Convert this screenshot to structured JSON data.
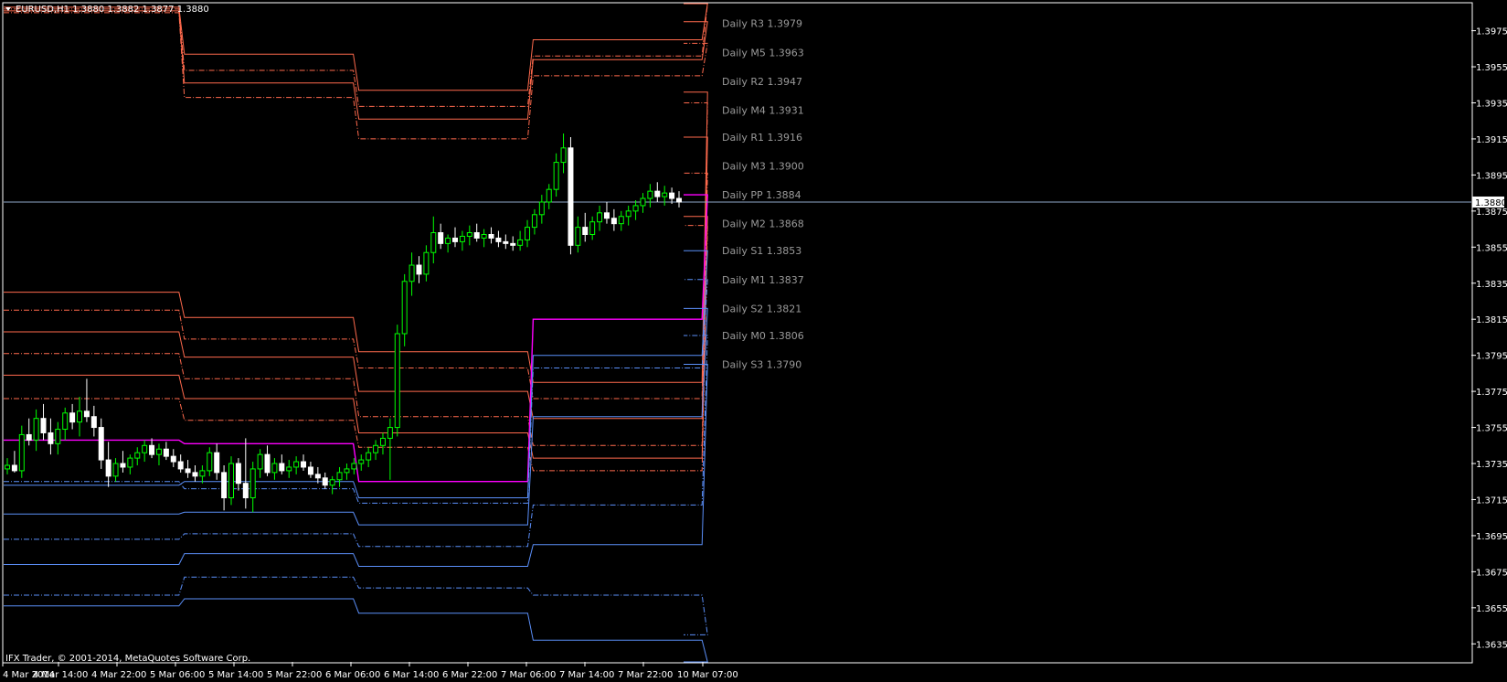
{
  "chart_title": "EURUSD,H1  1.3880 1.3882 1.3877 1.3880",
  "footer": "IFX Trader, © 2001-2014, MetaQuotes Software Corp.",
  "colors": {
    "background": "#000000",
    "grid_frame": "#ffffff",
    "bull_candle": "#00ff00",
    "bear_candle": "#ffffff",
    "resistance": "#ff6a4d",
    "pivot": "#ff00ff",
    "support": "#5b8ff9",
    "bid_line": "#8fa8c8",
    "label_text": "#9a9a9a"
  },
  "chart_data": {
    "type": "candlestick",
    "symbol": "EURUSD",
    "timeframe": "H1",
    "ylim": [
      1.3625,
      1.399
    ],
    "y_ticks": [
      "1.3975",
      "1.3955",
      "1.3935",
      "1.3915",
      "1.3895",
      "1.3875",
      "1.3855",
      "1.3835",
      "1.3815",
      "1.3795",
      "1.3775",
      "1.3755",
      "1.3735",
      "1.3715",
      "1.3695",
      "1.3675",
      "1.3655",
      "1.3635"
    ],
    "x_ticks": [
      "4 Mar 2014",
      "4 Mar 14:00",
      "4 Mar 22:00",
      "5 Mar 06:00",
      "5 Mar 14:00",
      "5 Mar 22:00",
      "6 Mar 06:00",
      "6 Mar 14:00",
      "6 Mar 22:00",
      "7 Mar 06:00",
      "7 Mar 14:00",
      "7 Mar 22:00",
      "10 Mar 07:00"
    ],
    "bar_range": [
      0,
      124
    ],
    "current_price": "1.3880",
    "candles_ohlc": [
      [
        1.3732,
        1.3738,
        1.3729,
        1.3734
      ],
      [
        1.3734,
        1.3742,
        1.373,
        1.3731
      ],
      [
        1.3731,
        1.3756,
        1.3727,
        1.3751
      ],
      [
        1.3751,
        1.376,
        1.3745,
        1.3748
      ],
      [
        1.3748,
        1.3765,
        1.3742,
        1.376
      ],
      [
        1.376,
        1.3768,
        1.3748,
        1.3752
      ],
      [
        1.3752,
        1.376,
        1.374,
        1.3746
      ],
      [
        1.3746,
        1.3758,
        1.374,
        1.3754
      ],
      [
        1.3754,
        1.3766,
        1.3748,
        1.3763
      ],
      [
        1.3763,
        1.3768,
        1.3754,
        1.3758
      ],
      [
        1.3758,
        1.3772,
        1.375,
        1.3764
      ],
      [
        1.3764,
        1.3782,
        1.3758,
        1.3761
      ],
      [
        1.3761,
        1.3767,
        1.375,
        1.3755
      ],
      [
        1.3755,
        1.376,
        1.3732,
        1.3737
      ],
      [
        1.3737,
        1.3747,
        1.3722,
        1.3728
      ],
      [
        1.3728,
        1.3738,
        1.3725,
        1.3735
      ],
      [
        1.3735,
        1.3742,
        1.373,
        1.3733
      ],
      [
        1.3733,
        1.374,
        1.3729,
        1.3738
      ],
      [
        1.3738,
        1.3744,
        1.3734,
        1.3741
      ],
      [
        1.3741,
        1.3748,
        1.3736,
        1.3745
      ],
      [
        1.3745,
        1.3749,
        1.3738,
        1.374
      ],
      [
        1.374,
        1.3746,
        1.3734,
        1.3743
      ],
      [
        1.3743,
        1.3747,
        1.3737,
        1.3739
      ],
      [
        1.3739,
        1.3743,
        1.3733,
        1.3736
      ],
      [
        1.3736,
        1.374,
        1.373,
        1.3732
      ],
      [
        1.3732,
        1.3737,
        1.3727,
        1.373
      ],
      [
        1.373,
        1.3734,
        1.3725,
        1.3728
      ],
      [
        1.3728,
        1.3734,
        1.3724,
        1.3731
      ],
      [
        1.3731,
        1.3744,
        1.3728,
        1.3741
      ],
      [
        1.3741,
        1.3746,
        1.3726,
        1.373
      ],
      [
        1.373,
        1.3734,
        1.3709,
        1.3716
      ],
      [
        1.3716,
        1.3739,
        1.3712,
        1.3735
      ],
      [
        1.3735,
        1.3738,
        1.372,
        1.3724
      ],
      [
        1.3724,
        1.3749,
        1.371,
        1.3716
      ],
      [
        1.3716,
        1.3736,
        1.3708,
        1.3732
      ],
      [
        1.3732,
        1.3743,
        1.3727,
        1.374
      ],
      [
        1.374,
        1.3745,
        1.3728,
        1.373
      ],
      [
        1.373,
        1.3738,
        1.3726,
        1.3735
      ],
      [
        1.3735,
        1.374,
        1.3729,
        1.3731
      ],
      [
        1.3731,
        1.3737,
        1.3727,
        1.3733
      ],
      [
        1.3733,
        1.3739,
        1.3729,
        1.3736
      ],
      [
        1.3736,
        1.374,
        1.3731,
        1.3733
      ],
      [
        1.3733,
        1.3736,
        1.3727,
        1.3729
      ],
      [
        1.3729,
        1.3733,
        1.3724,
        1.3727
      ],
      [
        1.3727,
        1.373,
        1.3721,
        1.3723
      ],
      [
        1.3723,
        1.3728,
        1.3718,
        1.3726
      ],
      [
        1.3726,
        1.3733,
        1.3722,
        1.373
      ],
      [
        1.373,
        1.3735,
        1.3726,
        1.3732
      ],
      [
        1.3732,
        1.3738,
        1.3729,
        1.3735
      ],
      [
        1.3735,
        1.374,
        1.3731,
        1.3737
      ],
      [
        1.3737,
        1.3744,
        1.3733,
        1.3741
      ],
      [
        1.3741,
        1.3748,
        1.3737,
        1.3745
      ],
      [
        1.3745,
        1.3752,
        1.374,
        1.3749
      ],
      [
        1.3749,
        1.376,
        1.3726,
        1.3755
      ],
      [
        1.3755,
        1.3812,
        1.375,
        1.3807
      ],
      [
        1.3807,
        1.384,
        1.38,
        1.3836
      ],
      [
        1.3836,
        1.3852,
        1.3828,
        1.3845
      ],
      [
        1.3845,
        1.385,
        1.3835,
        1.384
      ],
      [
        1.384,
        1.3856,
        1.3836,
        1.3852
      ],
      [
        1.3852,
        1.3872,
        1.3846,
        1.3863
      ],
      [
        1.3863,
        1.3868,
        1.3854,
        1.3857
      ],
      [
        1.3857,
        1.3862,
        1.3852,
        1.386
      ],
      [
        1.386,
        1.3866,
        1.3855,
        1.3858
      ],
      [
        1.3858,
        1.3864,
        1.3853,
        1.3861
      ],
      [
        1.3861,
        1.3867,
        1.3856,
        1.3863
      ],
      [
        1.3863,
        1.3868,
        1.3858,
        1.386
      ],
      [
        1.386,
        1.3865,
        1.3855,
        1.3862
      ],
      [
        1.3862,
        1.3866,
        1.3857,
        1.386
      ],
      [
        1.386,
        1.3864,
        1.3855,
        1.3858
      ],
      [
        1.3858,
        1.3862,
        1.3854,
        1.3857
      ],
      [
        1.3857,
        1.3861,
        1.3853,
        1.3856
      ],
      [
        1.3856,
        1.3864,
        1.3853,
        1.3859
      ],
      [
        1.3859,
        1.387,
        1.3855,
        1.3866
      ],
      [
        1.3866,
        1.3876,
        1.3862,
        1.3873
      ],
      [
        1.3873,
        1.3884,
        1.3868,
        1.388
      ],
      [
        1.388,
        1.389,
        1.3876,
        1.3887
      ],
      [
        1.3887,
        1.3907,
        1.3883,
        1.3902
      ],
      [
        1.3902,
        1.3918,
        1.3896,
        1.391
      ],
      [
        1.391,
        1.3916,
        1.3851,
        1.3856
      ],
      [
        1.3856,
        1.3872,
        1.3852,
        1.3866
      ],
      [
        1.3866,
        1.3874,
        1.3858,
        1.3862
      ],
      [
        1.3862,
        1.3872,
        1.3859,
        1.3869
      ],
      [
        1.3869,
        1.3878,
        1.3864,
        1.3874
      ],
      [
        1.3874,
        1.388,
        1.3868,
        1.3871
      ],
      [
        1.3871,
        1.3876,
        1.3864,
        1.3868
      ],
      [
        1.3868,
        1.3875,
        1.3864,
        1.3872
      ],
      [
        1.3872,
        1.3878,
        1.3867,
        1.3875
      ],
      [
        1.3875,
        1.3881,
        1.387,
        1.3878
      ],
      [
        1.3878,
        1.3885,
        1.3874,
        1.3882
      ],
      [
        1.3882,
        1.389,
        1.3877,
        1.3886
      ],
      [
        1.3886,
        1.3891,
        1.388,
        1.3883
      ],
      [
        1.3883,
        1.3889,
        1.3878,
        1.3885
      ],
      [
        1.3885,
        1.3888,
        1.3879,
        1.3882
      ],
      [
        1.3882,
        1.3886,
        1.3877,
        1.388
      ]
    ],
    "pivot_levels": [
      {
        "name": "R3",
        "label": "Daily R3 1.3979",
        "style": "solid",
        "color": "resistance",
        "segments": [
          1.3988,
          1.3962,
          1.3942,
          1.397,
          1.399
        ]
      },
      {
        "name": "M5",
        "label": "Daily M5 1.3963",
        "style": "dash",
        "color": "resistance",
        "segments": [
          1.3987,
          1.3953,
          1.3933,
          1.3961,
          1.399
        ]
      },
      {
        "name": "R2",
        "label": "Daily R2 1.3947",
        "style": "solid",
        "color": "resistance",
        "segments": [
          1.3986,
          1.3946,
          1.3926,
          1.3959,
          1.398
        ]
      },
      {
        "name": "M4",
        "label": "Daily M4 1.3931",
        "style": "dash",
        "color": "resistance",
        "segments": [
          1.3985,
          1.3938,
          1.3915,
          1.395,
          1.3968
        ]
      },
      {
        "name": "R1",
        "label": "Daily R1 1.3916",
        "style": "solid",
        "color": "resistance",
        "segments": [
          1.383,
          1.3816,
          1.3797,
          1.378,
          1.3941
        ]
      },
      {
        "name": "M3",
        "label": "Daily M3 1.3900",
        "style": "dash",
        "color": "resistance",
        "segments": [
          1.382,
          1.3804,
          1.3788,
          1.3771,
          1.3935
        ]
      },
      {
        "name": "R2b",
        "label": "",
        "style": "solid",
        "color": "resistance",
        "segments": [
          1.3808,
          1.3794,
          1.3775,
          1.376,
          1.3916
        ]
      },
      {
        "name": "M2",
        "label": "Daily M2 1.3868",
        "style": "dash",
        "color": "resistance",
        "segments": [
          1.3796,
          1.3782,
          1.3761,
          1.3745,
          1.3896
        ]
      },
      {
        "name": "R1b",
        "label": "",
        "style": "solid",
        "color": "resistance",
        "segments": [
          1.3784,
          1.3771,
          1.3752,
          1.3738,
          1.3872
        ]
      },
      {
        "name": "M1r",
        "label": "",
        "style": "dash",
        "color": "resistance",
        "segments": [
          1.3771,
          1.3759,
          1.3744,
          1.3731,
          1.3867
        ]
      },
      {
        "name": "PP",
        "label": "Daily PP 1.3884",
        "style": "solid",
        "color": "pivot",
        "segments": [
          1.3748,
          1.3746,
          1.3725,
          1.3815,
          1.3884
        ]
      },
      {
        "name": "S1",
        "label": "Daily S1 1.3853",
        "style": "solid",
        "color": "support",
        "segments": [
          1.3723,
          1.3725,
          1.3716,
          1.3795,
          1.3853
        ]
      },
      {
        "name": "M1",
        "label": "Daily M1 1.3837",
        "style": "dash",
        "color": "support",
        "segments": [
          1.3725,
          1.3721,
          1.3713,
          1.3788,
          1.3837
        ]
      },
      {
        "name": "S2",
        "label": "Daily S2 1.3821",
        "style": "solid",
        "color": "support",
        "segments": [
          1.3707,
          1.3708,
          1.3701,
          1.3761,
          1.3821
        ]
      },
      {
        "name": "M0",
        "label": "Daily M0 1.3806",
        "style": "dash",
        "color": "support",
        "segments": [
          1.3693,
          1.3696,
          1.3689,
          1.3712,
          1.3806
        ]
      },
      {
        "name": "S3",
        "label": "Daily S3 1.3790",
        "style": "solid",
        "color": "support",
        "segments": [
          1.3679,
          1.3685,
          1.3678,
          1.369,
          1.379
        ]
      },
      {
        "name": "S3b",
        "label": "",
        "style": "dash",
        "color": "support",
        "segments": [
          1.3662,
          1.3672,
          1.3666,
          1.3662,
          1.364
        ]
      },
      {
        "name": "S4",
        "label": "",
        "style": "solid",
        "color": "support",
        "segments": [
          1.3656,
          1.366,
          1.3652,
          1.3637,
          1.3625
        ]
      }
    ],
    "day_breaks": [
      0,
      24,
      48,
      72,
      96,
      124
    ]
  }
}
